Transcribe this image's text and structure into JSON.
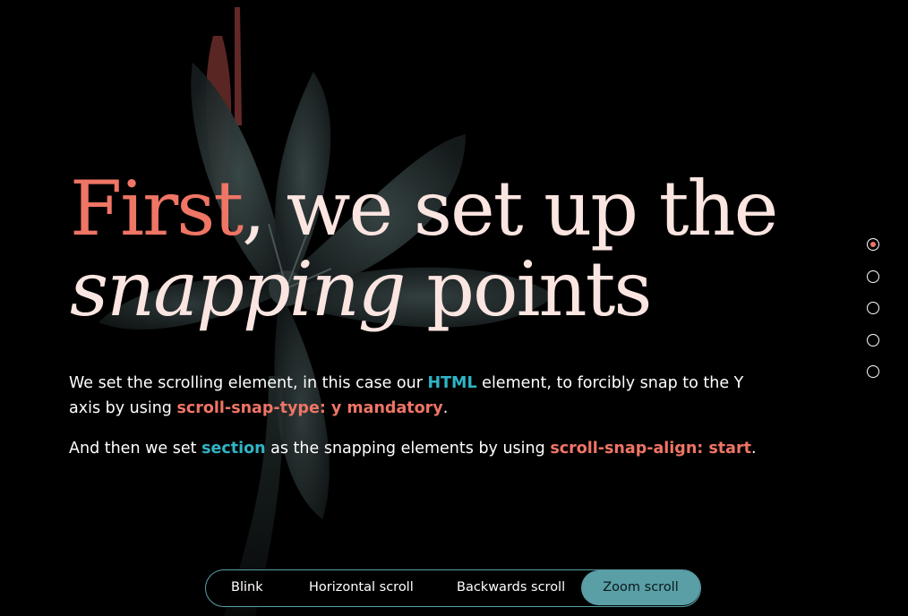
{
  "heading": {
    "first": "First",
    "rest_line1": ", we set up the",
    "italic": "snapping",
    "rest_line2": " points"
  },
  "paragraph1": {
    "text_a": "We set the scrolling element, in this case our ",
    "kw_html": "HTML",
    "text_b": " element, to forcibly snap to the Y axis by using ",
    "kw_snap_type": "scroll-snap-type: y mandatory",
    "text_c": "."
  },
  "paragraph2": {
    "text_a": "And then we set ",
    "kw_section": "section",
    "text_b": " as the snapping elements by using ",
    "kw_snap_align": "scroll-snap-align: start",
    "text_c": "."
  },
  "pagination": {
    "count": 5,
    "active_index": 0
  },
  "nav": {
    "items": [
      "Blink",
      "Horizontal scroll",
      "Backwards scroll",
      "Zoom scroll"
    ],
    "active": "Zoom scroll"
  },
  "colors": {
    "accent_coral": "#ef7565",
    "accent_teal": "#2fb4c6",
    "nav_active": "#5a9ea6",
    "background": "#000000"
  }
}
